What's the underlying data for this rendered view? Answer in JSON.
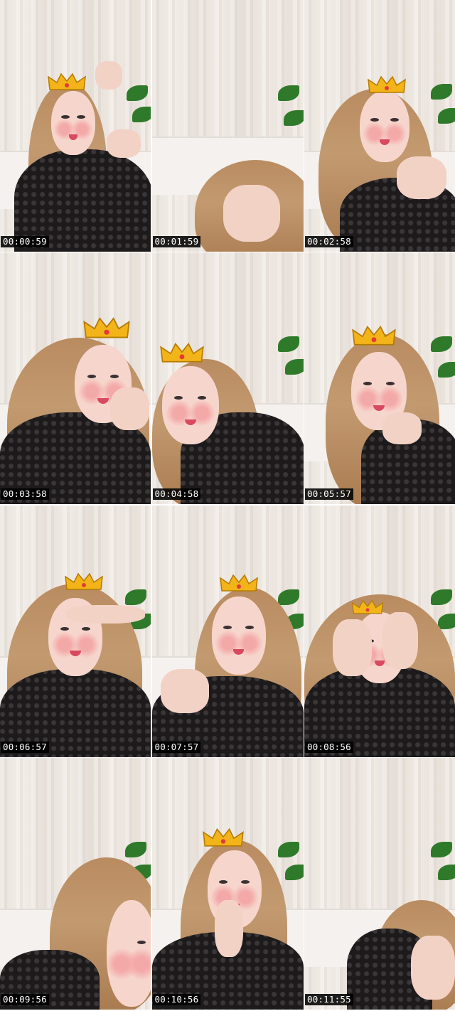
{
  "frames": [
    {
      "timestamp": "00:00:59"
    },
    {
      "timestamp": "00:01:59"
    },
    {
      "timestamp": "00:02:58"
    },
    {
      "timestamp": "00:03:58"
    },
    {
      "timestamp": "00:04:58"
    },
    {
      "timestamp": "00:05:57"
    },
    {
      "timestamp": "00:06:57"
    },
    {
      "timestamp": "00:07:57"
    },
    {
      "timestamp": "00:08:56"
    },
    {
      "timestamp": "00:09:56"
    },
    {
      "timestamp": "00:10:56"
    },
    {
      "timestamp": "00:11:55"
    }
  ],
  "colors": {
    "timestamp_bg": "#000000",
    "timestamp_text": "#ffffff",
    "crown": "#f2b418",
    "hair": "#b98b60",
    "lace_top": "#1f1c1d",
    "plant": "#2f7a2a"
  }
}
